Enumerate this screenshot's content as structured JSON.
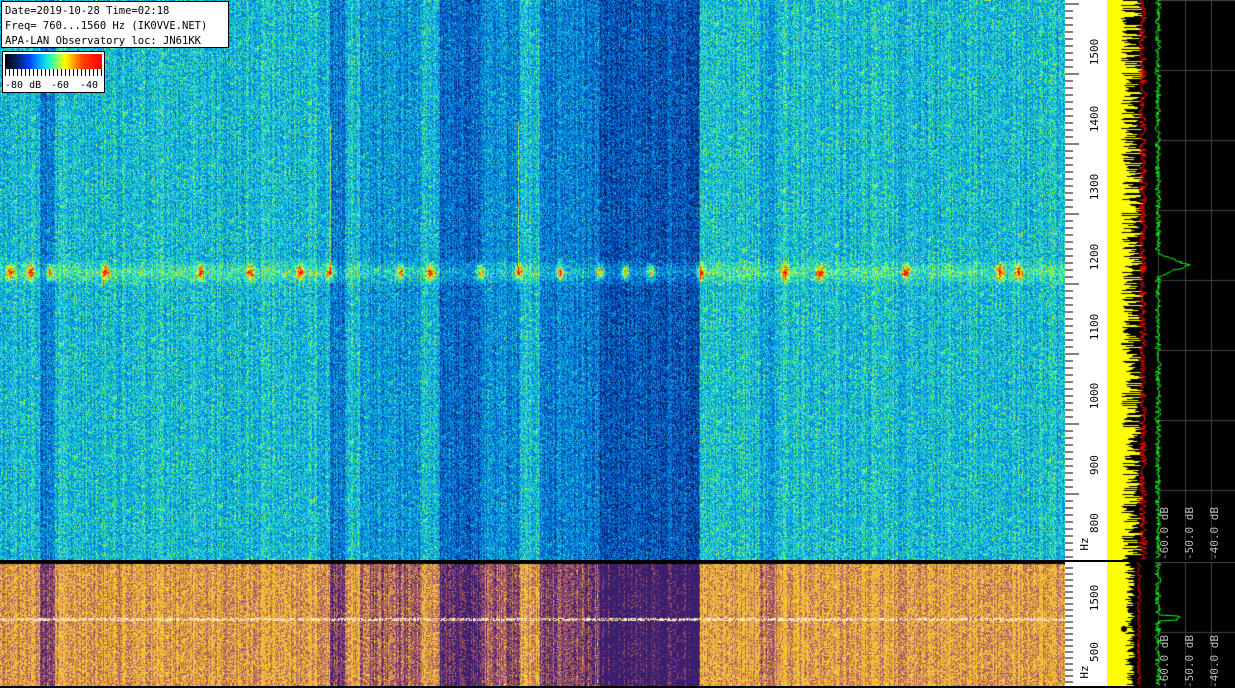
{
  "info": {
    "line1": "Date=2019-10-28 Time=02:18",
    "line2": "Freq= 760...1560 Hz (IK0VVE.NET)",
    "line3": "APA-LAN Observatory loc: JN61KK"
  },
  "legend": {
    "labels": [
      "-80 dB",
      "-60",
      "-40"
    ]
  },
  "axis_main": {
    "ticks": [
      {
        "value": 1500,
        "label": "1500"
      },
      {
        "value": 1400,
        "label": "1400"
      },
      {
        "value": 1300,
        "label": "1300"
      },
      {
        "value": 1200,
        "label": "1200"
      },
      {
        "value": 1100,
        "label": "1100"
      },
      {
        "value": 1000,
        "label": "1000"
      },
      {
        "value": 900,
        "label": "900"
      },
      {
        "value": 800,
        "label": "800"
      }
    ],
    "unit": "Hz"
  },
  "axis_low": {
    "ticks": [
      {
        "label": "1500"
      },
      {
        "label": "500"
      }
    ],
    "unit": "Hz"
  },
  "spectrum_main": {
    "db_labels": [
      "-60.0 dB",
      "-50.0 dB",
      "-40.0 dB"
    ]
  },
  "spectrum_low": {
    "db_labels": [
      "-60.0 dB",
      "-50.0 dB",
      "-40.0 dB"
    ]
  },
  "colors": {
    "level_bar": "#ffff00",
    "spectrum_trace": "#00ff00",
    "peak_marker": "#ff0000",
    "grid": "#444444"
  }
}
